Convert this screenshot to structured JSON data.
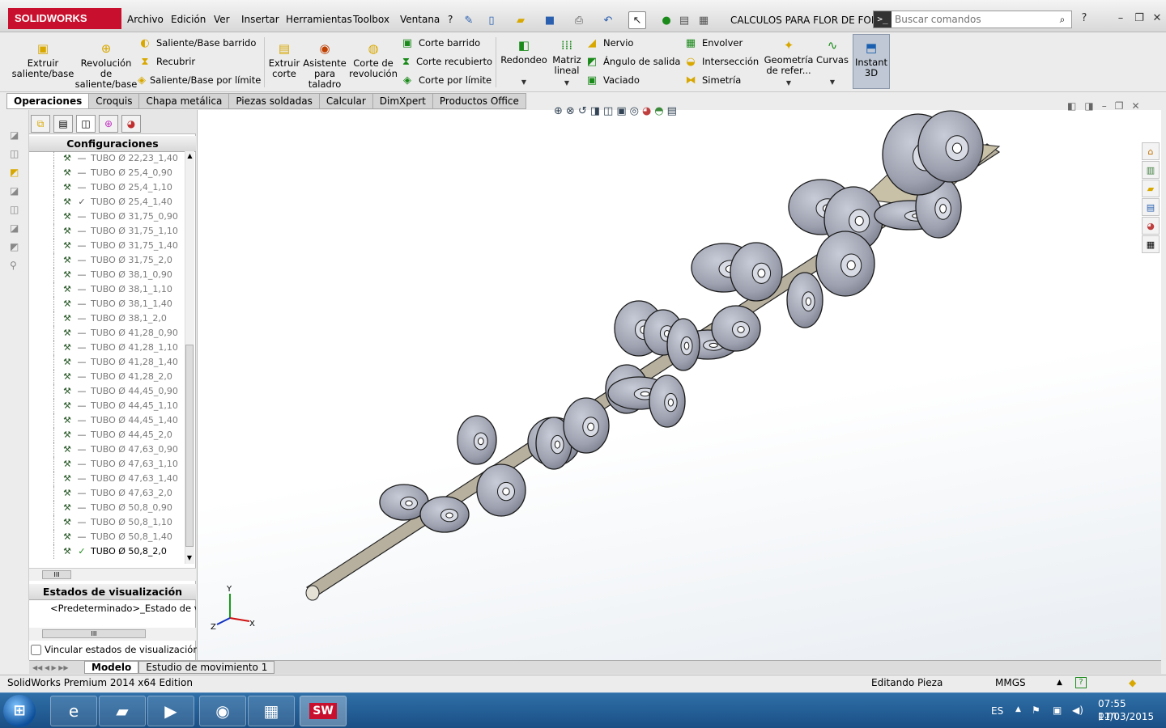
{
  "app": {
    "logo": "SOLIDWORKS",
    "menu": [
      "Archivo",
      "Edición",
      "Ver",
      "Insertar",
      "Herramientas",
      "Toolbox",
      "Ventana",
      "?"
    ],
    "document_title": "CALCULOS PARA FLOR DE FOR...",
    "search_placeholder": "Buscar comandos"
  },
  "ribbon": {
    "extrude_boss": "Extruir saliente/base",
    "revolve_boss": "Revolución de saliente/base",
    "swept_boss": "Saliente/Base barrido",
    "loft": "Recubrir",
    "boundary_boss": "Saliente/Base por límite",
    "extrude_cut": "Extruir corte",
    "hole_wizard": "Asistente para taladro",
    "revolve_cut": "Corte de revolución",
    "swept_cut": "Corte barrido",
    "lofted_cut": "Corte recubierto",
    "boundary_cut": "Corte por límite",
    "fillet": "Redondeo",
    "linear_pattern": "Matriz lineal",
    "rib": "Nervio",
    "draft": "Ángulo de salida",
    "shell": "Vaciado",
    "wrap": "Envolver",
    "intersect": "Intersección",
    "mirror": "Simetría",
    "ref_geometry": "Geometría de refer...",
    "curves": "Curvas",
    "instant3d": "Instant 3D"
  },
  "tabs": [
    {
      "label": "Operaciones",
      "active": true
    },
    {
      "label": "Croquis",
      "active": false
    },
    {
      "label": "Chapa metálica",
      "active": false
    },
    {
      "label": "Piezas soldadas",
      "active": false
    },
    {
      "label": "Calcular",
      "active": false
    },
    {
      "label": "DimXpert",
      "active": false
    },
    {
      "label": "Productos Office",
      "active": false
    }
  ],
  "panel": {
    "configurations_header": "Configuraciones",
    "configurations": [
      {
        "name": "TUBO Ø 22,23_1,40",
        "state": "none"
      },
      {
        "name": "TUBO Ø 25,4_0,90",
        "state": "none"
      },
      {
        "name": "TUBO Ø 25,4_1,10",
        "state": "none"
      },
      {
        "name": "TUBO Ø 25,4_1,40",
        "state": "check"
      },
      {
        "name": "TUBO Ø 31,75_0,90",
        "state": "none"
      },
      {
        "name": "TUBO Ø 31,75_1,10",
        "state": "none"
      },
      {
        "name": "TUBO Ø 31,75_1,40",
        "state": "none"
      },
      {
        "name": "TUBO Ø 31,75_2,0",
        "state": "none"
      },
      {
        "name": "TUBO Ø 38,1_0,90",
        "state": "none"
      },
      {
        "name": "TUBO Ø 38,1_1,10",
        "state": "none"
      },
      {
        "name": "TUBO Ø 38,1_1,40",
        "state": "none"
      },
      {
        "name": "TUBO Ø 38,1_2,0",
        "state": "none"
      },
      {
        "name": "TUBO Ø 41,28_0,90",
        "state": "none"
      },
      {
        "name": "TUBO Ø 41,28_1,10",
        "state": "none"
      },
      {
        "name": "TUBO Ø 41,28_1,40",
        "state": "none"
      },
      {
        "name": "TUBO Ø 41,28_2,0",
        "state": "none"
      },
      {
        "name": "TUBO Ø 44,45_0,90",
        "state": "none"
      },
      {
        "name": "TUBO Ø 44,45_1,10",
        "state": "none"
      },
      {
        "name": "TUBO Ø 44,45_1,40",
        "state": "none"
      },
      {
        "name": "TUBO Ø 44,45_2,0",
        "state": "none"
      },
      {
        "name": "TUBO Ø 47,63_0,90",
        "state": "none"
      },
      {
        "name": "TUBO Ø 47,63_1,10",
        "state": "none"
      },
      {
        "name": "TUBO Ø 47,63_1,40",
        "state": "none"
      },
      {
        "name": "TUBO Ø 47,63_2,0",
        "state": "none"
      },
      {
        "name": "TUBO Ø 50,8_0,90",
        "state": "none"
      },
      {
        "name": "TUBO Ø 50,8_1,10",
        "state": "none"
      },
      {
        "name": "TUBO Ø 50,8_1,40",
        "state": "none"
      },
      {
        "name": "TUBO Ø 50,8_2,0",
        "state": "active"
      }
    ],
    "display_states_header": "Estados de visualización",
    "display_state_item": "<Predeterminado>_Estado de v",
    "link_display_states": "Vincular estados de visualización a c",
    "scroll_label": "III"
  },
  "bottom_tabs": [
    {
      "label": "Modelo",
      "active": true
    },
    {
      "label": "Estudio de movimiento 1",
      "active": false
    }
  ],
  "status": {
    "edition": "SolidWorks Premium 2014 x64 Edition",
    "mode": "Editando Pieza",
    "units": "MMGS"
  },
  "taskbar": {
    "language": "ES",
    "time": "07:55 p.m.",
    "date": "11/03/2015"
  },
  "axes": {
    "x": "X",
    "y": "Y",
    "z": "Z"
  },
  "colors": {
    "brand": "#c8102e",
    "taskbar": "#1a4f85",
    "part": "#aeb2bf"
  }
}
